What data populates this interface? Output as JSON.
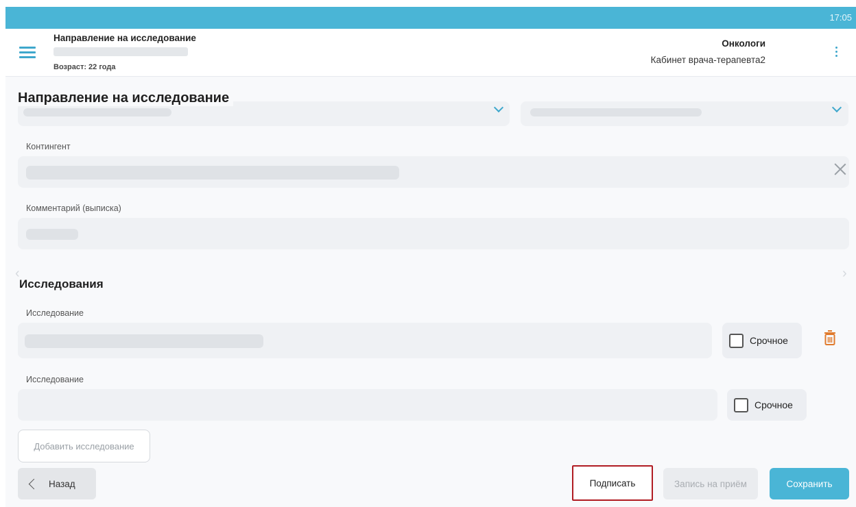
{
  "status_bar": {
    "time": "17:05"
  },
  "header": {
    "title": "Направление на исследование",
    "age": "Возраст: 22 года",
    "department": "Онкологи",
    "room": "Кабинет врача-терапевта2"
  },
  "page": {
    "title": "Направление на исследование"
  },
  "form": {
    "contingent_label": "Контингент",
    "comment_label": "Комментарий (выписка)"
  },
  "studies": {
    "section_title": "Исследования",
    "items": [
      {
        "label": "Исследование",
        "urgent_label": "Срочное"
      },
      {
        "label": "Исследование",
        "urgent_label": "Срочное"
      }
    ],
    "add_label": "Добавить исследование"
  },
  "footer": {
    "back_label": "Назад",
    "sign_label": "Подписать",
    "appointment_label": "Запись на приём",
    "save_label": "Сохранить"
  },
  "colors": {
    "accent": "#4ab5d6",
    "sign_outline": "#b01b22",
    "trash": "#e07a2c"
  }
}
